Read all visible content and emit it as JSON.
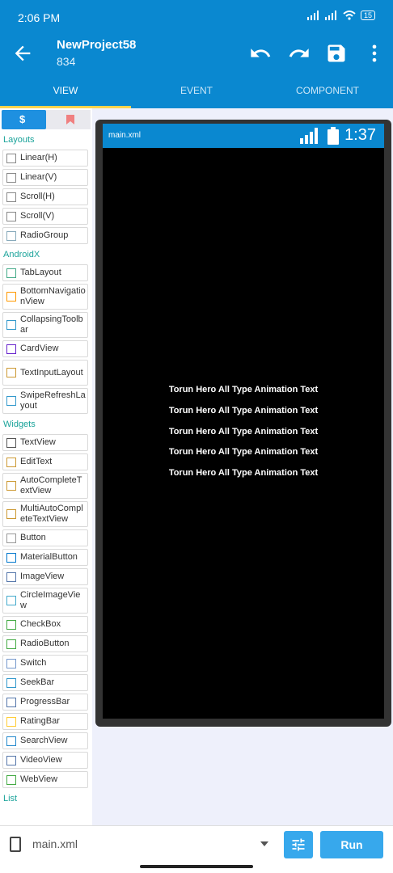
{
  "status": {
    "time": "2:06 PM",
    "battery": "15"
  },
  "appbar": {
    "title": "NewProject58",
    "subtitle": "834"
  },
  "tabs": [
    {
      "label": "VIEW",
      "active": true
    },
    {
      "label": "EVENT",
      "active": false
    },
    {
      "label": "COMPONENT",
      "active": false
    }
  ],
  "palette": {
    "sections": [
      {
        "title": "Layouts",
        "items": [
          {
            "label": "Linear(H)",
            "icon": "linear-h-icon"
          },
          {
            "label": "Linear(V)",
            "icon": "linear-v-icon"
          },
          {
            "label": "Scroll(H)",
            "icon": "scroll-h-icon"
          },
          {
            "label": "Scroll(V)",
            "icon": "scroll-v-icon"
          },
          {
            "label": "RadioGroup",
            "icon": "radiogroup-icon"
          }
        ]
      },
      {
        "title": "AndroidX",
        "items": [
          {
            "label": "TabLayout",
            "icon": "tablayout-icon"
          },
          {
            "label": "BottomNavigationView",
            "icon": "home-icon"
          },
          {
            "label": "CollapsingToolbar",
            "icon": "toolbar-icon"
          },
          {
            "label": "CardView",
            "icon": "cardview-icon"
          },
          {
            "label": "TextInputLayout",
            "icon": "textinput-icon"
          },
          {
            "label": "SwipeRefreshLayout",
            "icon": "refresh-icon"
          }
        ]
      },
      {
        "title": "Widgets",
        "items": [
          {
            "label": "TextView",
            "icon": "textview-icon"
          },
          {
            "label": "EditText",
            "icon": "edittext-icon"
          },
          {
            "label": "AutoCompleteTextView",
            "icon": "autocomplete-icon"
          },
          {
            "label": "MultiAutoCompleteTextView",
            "icon": "multiautocomplete-icon"
          },
          {
            "label": "Button",
            "icon": "button-icon"
          },
          {
            "label": "MaterialButton",
            "icon": "materialbutton-icon"
          },
          {
            "label": "ImageView",
            "icon": "image-icon"
          },
          {
            "label": "CircleImageView",
            "icon": "circleimage-icon"
          },
          {
            "label": "CheckBox",
            "icon": "checkbox-icon"
          },
          {
            "label": "RadioButton",
            "icon": "radiobutton-icon"
          },
          {
            "label": "Switch",
            "icon": "switch-icon"
          },
          {
            "label": "SeekBar",
            "icon": "seekbar-icon"
          },
          {
            "label": "ProgressBar",
            "icon": "progressbar-icon"
          },
          {
            "label": "RatingBar",
            "icon": "star-icon"
          },
          {
            "label": "SearchView",
            "icon": "search-icon"
          },
          {
            "label": "VideoView",
            "icon": "video-icon"
          },
          {
            "label": "WebView",
            "icon": "web-icon"
          }
        ]
      },
      {
        "title": "List",
        "items": []
      }
    ]
  },
  "preview": {
    "file": "main.xml",
    "clock": "1:37",
    "lines": [
      "Torun Hero All Type Animation Text",
      "Torun Hero All Type Animation Text",
      "Torun Hero All Type Animation Text",
      "Torun Hero All Type Animation Text",
      "Torun Hero All Type Animation Text"
    ]
  },
  "bottom": {
    "file": "main.xml",
    "run_label": "Run"
  },
  "colors": {
    "primary": "#0a88d0",
    "accent": "#37a8ec",
    "section": "#1aa39a"
  }
}
